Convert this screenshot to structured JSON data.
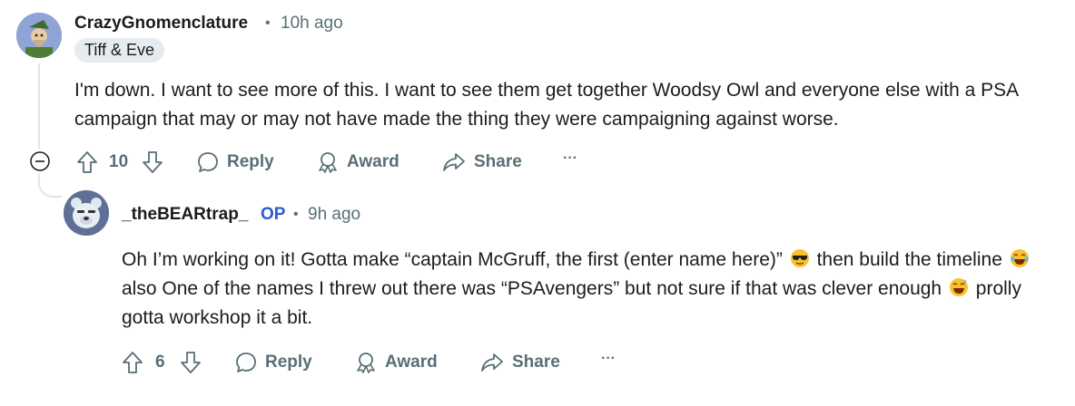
{
  "comments": [
    {
      "username": "CrazyGnomenclature",
      "separator": "•",
      "time": "10h ago",
      "flair": "Tiff & Eve",
      "body": "I'm down. I want to see more of this. I want to see them get together Woodsy Owl and everyone else with a PSA campaign that may or may not have made the thing they were campaigning against worse.",
      "votes": "10",
      "actions": {
        "reply": "Reply",
        "award": "Award",
        "share": "Share",
        "more": "···"
      }
    },
    {
      "username": "_theBEARtrap_",
      "op_badge": "OP",
      "separator": "•",
      "time": "9h ago",
      "body_parts": {
        "p1": "Oh I’m working on it! Gotta make “captain McGruff, the first (enter name here)”",
        "p2": " then build the timeline ",
        "p3": "also One of the names I threw out there was “PSAvengers” but not sure if that was clever enough ",
        "p4": " prolly gotta workshop it a bit."
      },
      "votes": "6",
      "actions": {
        "reply": "Reply",
        "award": "Award",
        "share": "Share",
        "more": "···"
      }
    }
  ],
  "icons": {
    "collapse": "minus-circle-icon",
    "upvote": "arrow-up-icon",
    "downvote": "arrow-down-icon",
    "reply": "speech-bubble-icon",
    "award": "award-ribbon-icon",
    "share": "share-arrow-icon"
  },
  "colors": {
    "meta": "#576f76",
    "op": "#2a5bd7",
    "flair_bg": "#e5ebee",
    "thread_line": "#e0e5e8"
  }
}
